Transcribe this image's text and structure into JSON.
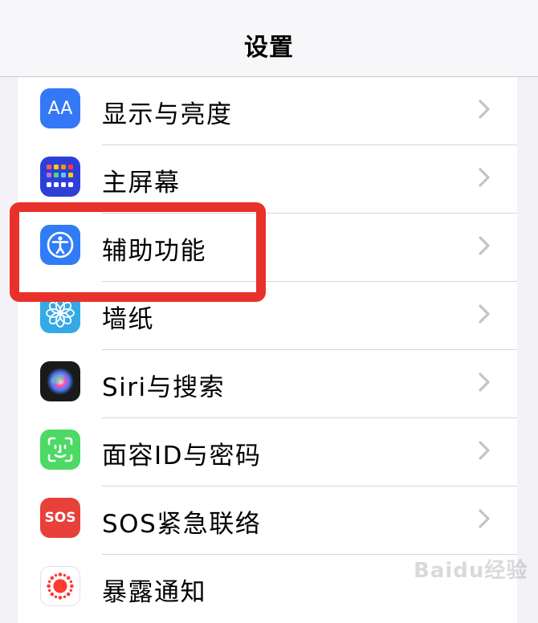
{
  "header": {
    "title": "设置"
  },
  "settings": {
    "items": [
      {
        "label": "显示与亮度",
        "icon": "display-brightness-icon",
        "icon_text": "AA",
        "icon_color": "#3478f6"
      },
      {
        "label": "主屏幕",
        "icon": "home-screen-icon",
        "icon_color": "#2c40d8"
      },
      {
        "label": "辅助功能",
        "icon": "accessibility-icon",
        "icon_color": "#2f7cf6"
      },
      {
        "label": "墙纸",
        "icon": "wallpaper-icon",
        "icon_color": "#35a9e6"
      },
      {
        "label": "Siri与搜索",
        "icon": "siri-icon",
        "icon_color": "#1a1a1a"
      },
      {
        "label": "面容ID与密码",
        "icon": "face-id-icon",
        "icon_color": "#4cd964"
      },
      {
        "label": "SOS紧急联络",
        "icon": "sos-icon",
        "icon_text": "SOS",
        "icon_color": "#e8413a"
      },
      {
        "label": "暴露通知",
        "icon": "exposure-notification-icon",
        "icon_color": "#ff3b30"
      }
    ]
  },
  "annotation": {
    "highlight_color": "#e8312b"
  },
  "watermark": {
    "text": "Baidu经验"
  }
}
